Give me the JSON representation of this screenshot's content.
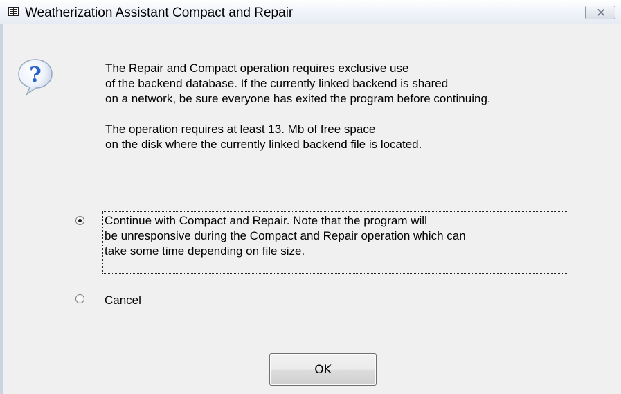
{
  "window": {
    "title": "Weatherization Assistant Compact and Repair",
    "app_icon": "form-icon",
    "close_glyph": "✕"
  },
  "message": {
    "icon": "question-icon",
    "para1": [
      "The Repair and Compact operation requires exclusive use",
      "of the backend database.  If the currently linked backend is shared",
      "on a network, be sure everyone has exited the program before continuing."
    ],
    "para2": [
      "The operation requires at least 13. Mb of free space",
      "on the disk where the currently linked backend file is located."
    ]
  },
  "options": [
    {
      "lines": [
        "Continue with Compact and Repair.  Note that the program will",
        "be unresponsive during the Compact and Repair operation which can",
        "take some time depending on file size."
      ],
      "selected": true
    },
    {
      "lines": [
        "Cancel"
      ],
      "selected": false
    }
  ],
  "buttons": {
    "ok_label": "OK"
  },
  "colors": {
    "dialog_background": "#f0f0f0",
    "icon_blue": "#2b63c9"
  }
}
